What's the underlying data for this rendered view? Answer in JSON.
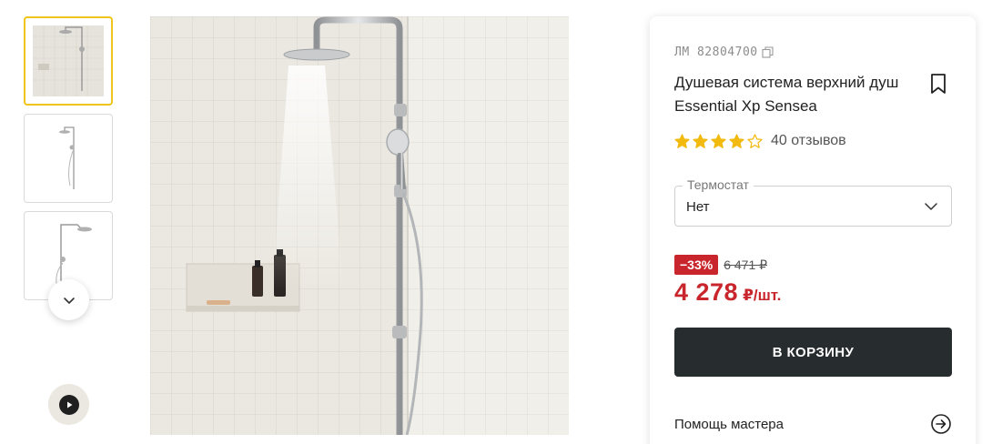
{
  "gallery": {
    "thumbnails": [
      {
        "name": "thumb-main-photo",
        "active": true
      },
      {
        "name": "thumb-product-side",
        "active": false
      },
      {
        "name": "thumb-product-front",
        "active": false
      }
    ],
    "scroll_icon": "chevron-down-icon",
    "video_icon": "play-icon"
  },
  "product": {
    "sku_label": "ЛМ 82804700",
    "title": "Душевая система верхний душ Essential Xp Sensea",
    "rating": 4,
    "rating_max": 5,
    "reviews": "40 отзывов"
  },
  "option": {
    "label": "Термостат",
    "value": "Нет"
  },
  "price": {
    "discount": "−33%",
    "old": "6 471 ₽",
    "current": "4 278",
    "unit": "₽/шт."
  },
  "actions": {
    "cart_label": "В КОРЗИНУ",
    "help_label": "Помощь мастера"
  },
  "colors": {
    "accent_yellow": "#f0c419",
    "sale_red": "#c8262c",
    "button_dark": "#272c2f",
    "star_gold": "#f2b90f"
  }
}
